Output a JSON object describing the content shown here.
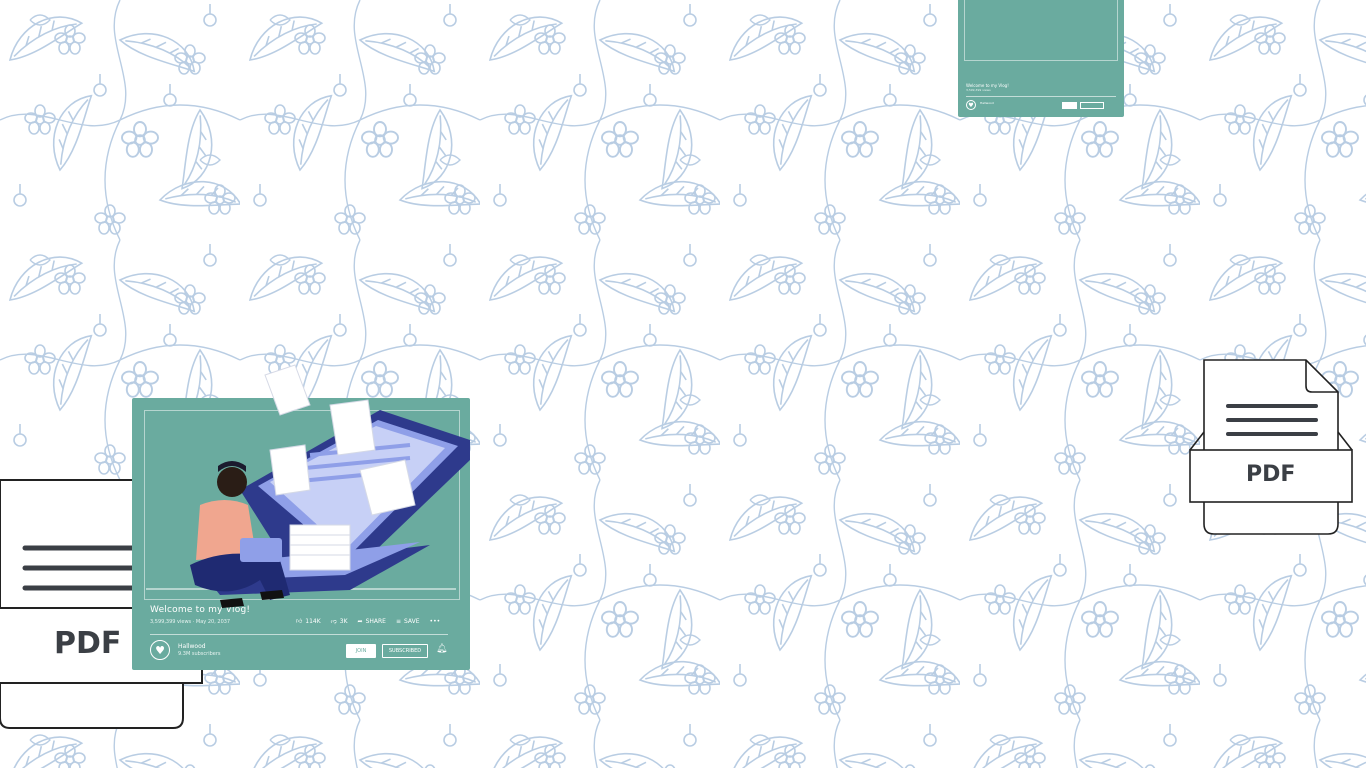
{
  "video_card": {
    "title": "Welcome to my Vlog!",
    "meta": "3,599,399 views · May 20, 2037",
    "likes": "114K",
    "dislikes": "3K",
    "share": "SHARE",
    "save": "SAVE",
    "more": "•••",
    "channel": "Hallwood",
    "subscribers": "9.3M subscribers",
    "join": "JOIN",
    "subscribed": "SUBSCRIBED",
    "icons": [
      "like-icon",
      "dislike-icon",
      "share-icon",
      "save-icon",
      "more-icon",
      "heart-icon",
      "bell-icon"
    ]
  },
  "mini_card": {
    "title": "Welcome to my Vlog!",
    "meta": "3,599,399 views",
    "channel": "Hallwood"
  },
  "pdf_left": {
    "label": "PDF"
  },
  "pdf_right": {
    "label": "PDF"
  },
  "colors": {
    "pattern": "#b9cde3",
    "card": "#6aab9f",
    "laptop": "#2e3a8c",
    "laptop_light": "#8f9fe8"
  }
}
